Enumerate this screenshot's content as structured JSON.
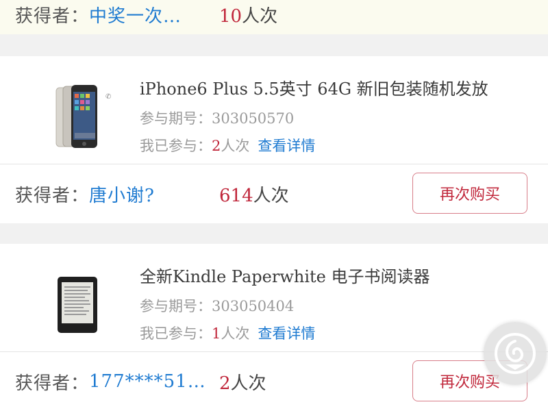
{
  "top_winner": {
    "label": "获得者：",
    "name": "中奖一次…",
    "count_number": "10",
    "count_suffix": "人次"
  },
  "items": [
    {
      "title": "iPhone6 Plus 5.5英寸 64G 新旧包装随机发放",
      "period_label": "参与期号：",
      "period_value": "303050570",
      "joined_label": "我已参与：",
      "joined_number": "2",
      "joined_suffix": "人次",
      "details_link": "查看详情",
      "winner_label": "获得者：",
      "winner_name": "唐小谢?",
      "winner_count_number": "614",
      "winner_count_suffix": "人次",
      "buy_again": "再次购买",
      "thumb_icon": "iphone-thumbnail"
    },
    {
      "title": "全新Kindle Paperwhite 电子书阅读器",
      "period_label": "参与期号：",
      "period_value": "303050404",
      "joined_label": "我已参与：",
      "joined_number": "1",
      "joined_suffix": "人次",
      "details_link": "查看详情",
      "winner_label": "获得者：",
      "winner_name": "177****51…",
      "winner_count_number": "2",
      "winner_count_suffix": "人次",
      "buy_again": "再次购买",
      "thumb_icon": "kindle-thumbnail"
    }
  ],
  "colors": {
    "accent_red": "#c0263a",
    "link_blue": "#1f7bd1",
    "page_bg": "#f1f1f1"
  }
}
